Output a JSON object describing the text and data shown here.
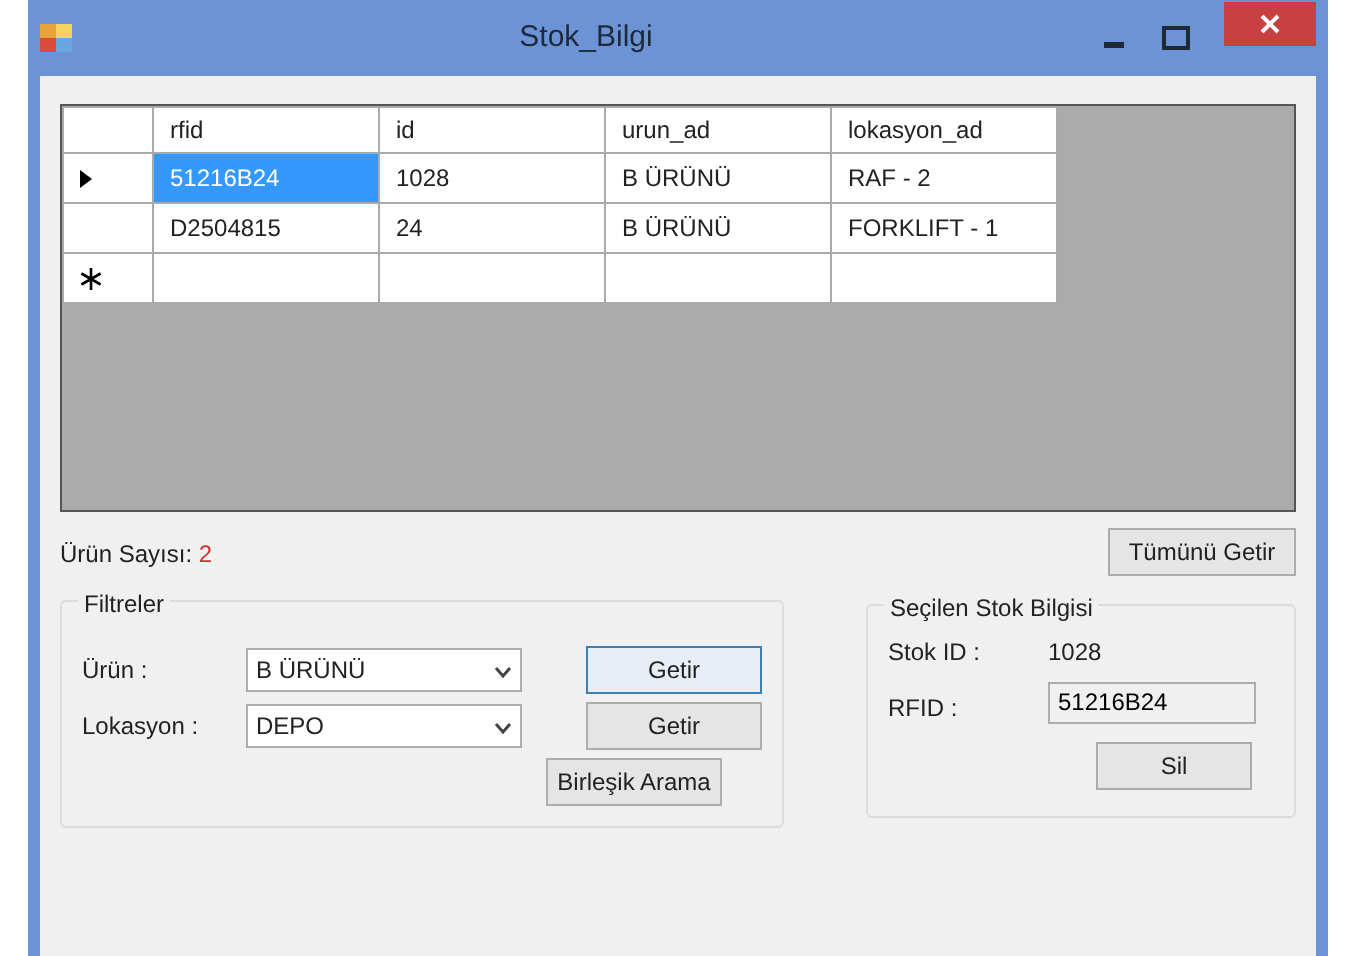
{
  "window": {
    "title": "Stok_Bilgi"
  },
  "table": {
    "columns": [
      "rfid",
      "id",
      "urun_ad",
      "lokasyon_ad"
    ],
    "rows": [
      {
        "current": true,
        "cells": [
          {
            "text": "51216B24",
            "selected": true
          },
          {
            "text": "1028",
            "selected": false
          },
          {
            "text": "B ÜRÜNÜ",
            "selected": false
          },
          {
            "text": "RAF - 2",
            "selected": false
          }
        ]
      },
      {
        "current": false,
        "cells": [
          {
            "text": "D2504815",
            "selected": false
          },
          {
            "text": "24",
            "selected": false
          },
          {
            "text": "B ÜRÜNÜ",
            "selected": false
          },
          {
            "text": "FORKLIFT - 1",
            "selected": false
          }
        ]
      }
    ],
    "new_row": true
  },
  "count": {
    "label": "Ürün Sayısı:",
    "value": "2"
  },
  "all_button": "Tümünü Getir",
  "filters": {
    "title": "Filtreler",
    "items": [
      {
        "label": "Ürün :",
        "value": "B ÜRÜNÜ",
        "button": "Getir",
        "focused": true
      },
      {
        "label": "Lokasyon :",
        "value": "DEPO",
        "button": "Getir",
        "focused": false
      }
    ],
    "combined_button": "Birleşik Arama"
  },
  "selected_info": {
    "title": "Seçilen Stok Bilgisi",
    "stock_id_label": "Stok ID :",
    "stock_id": "1028",
    "rfid_label": "RFID :",
    "rfid": "51216B24",
    "delete_button": "Sil"
  }
}
